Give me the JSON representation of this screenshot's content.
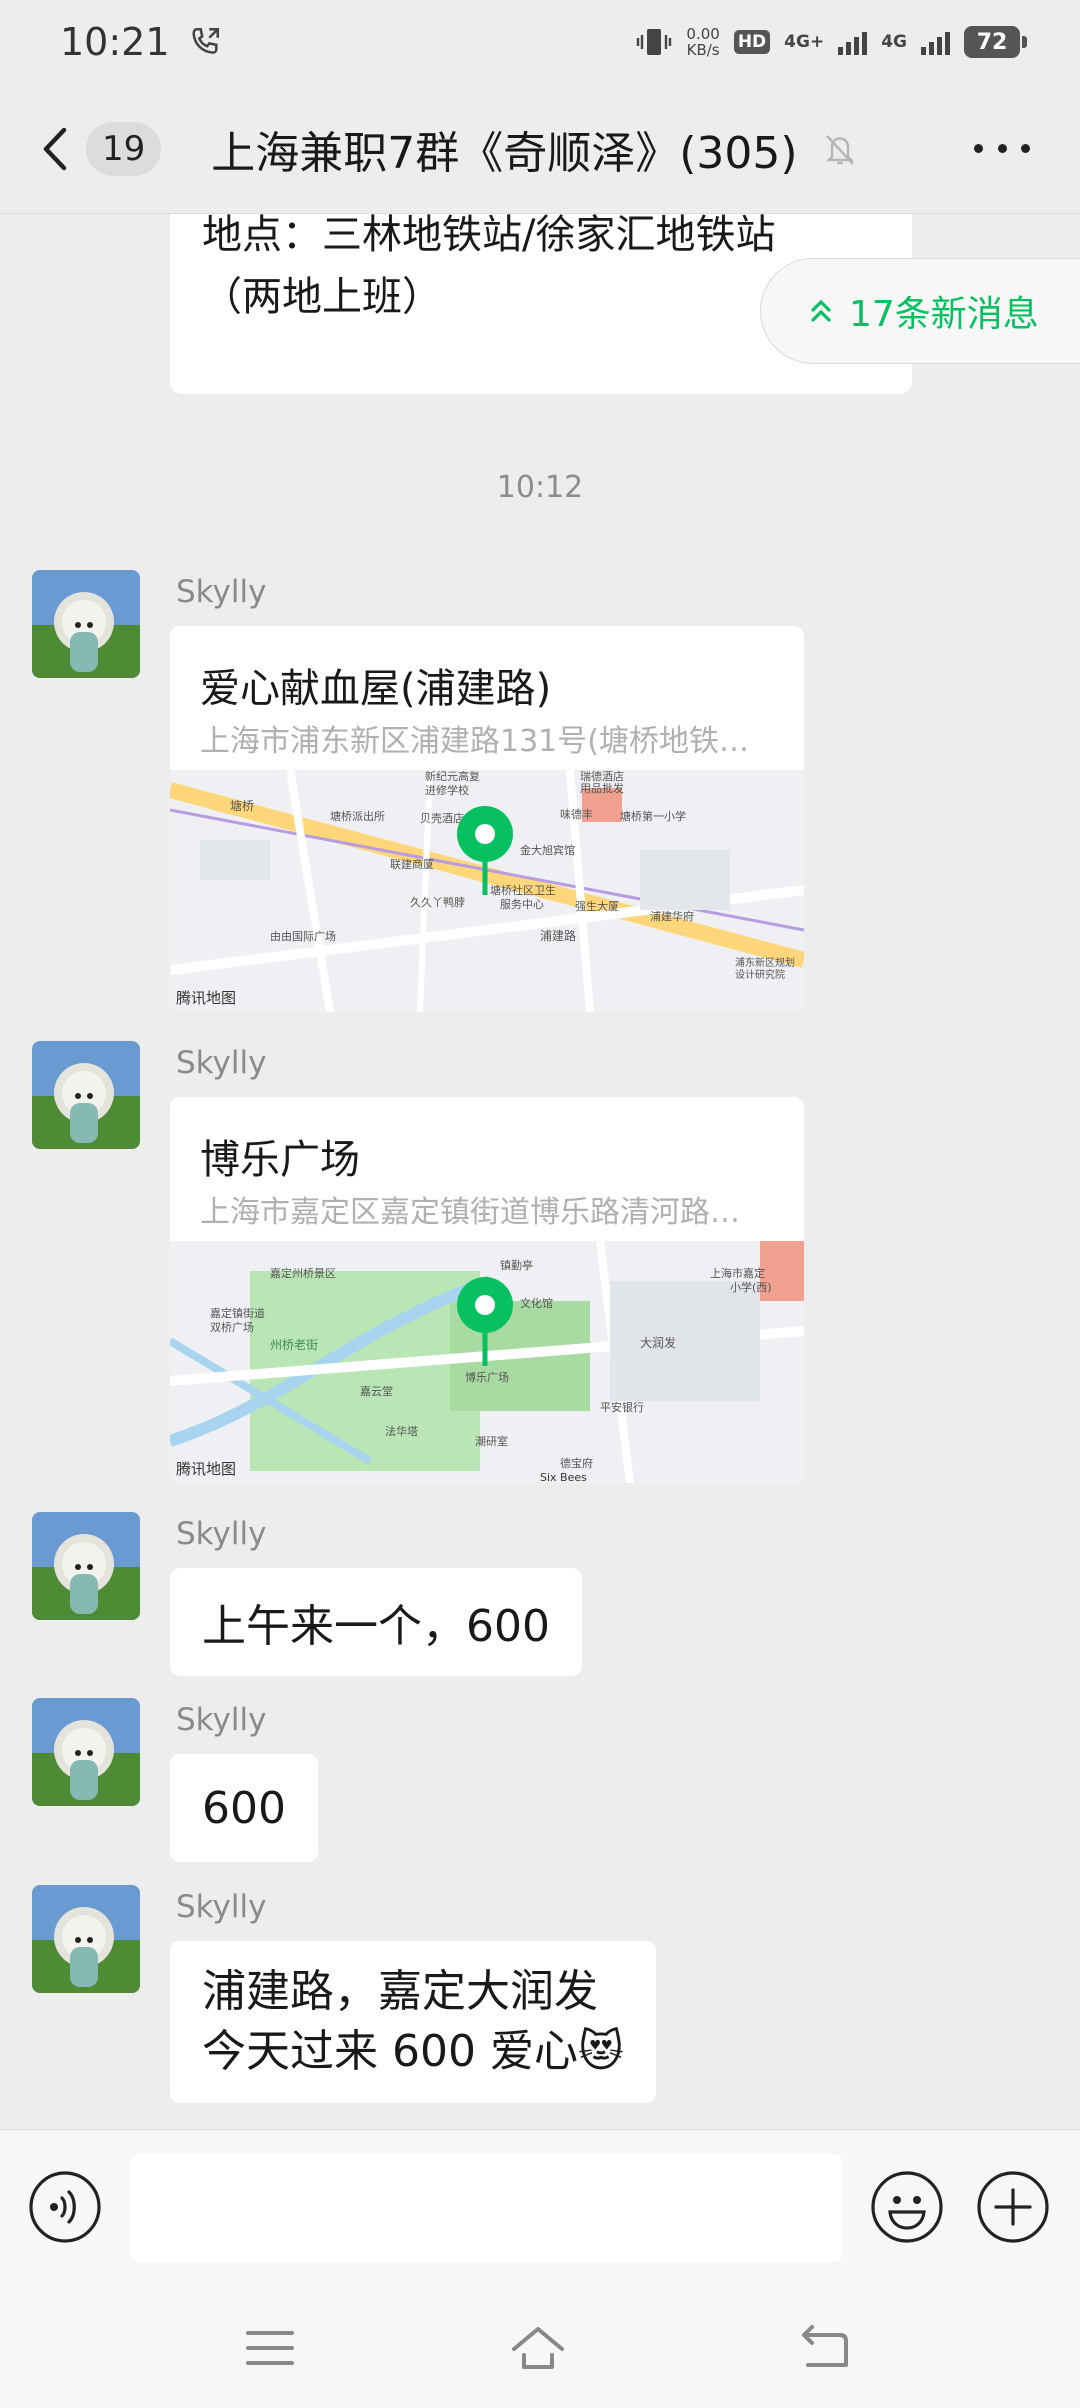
{
  "status_bar": {
    "time": "10:21",
    "speed_value": "0.00",
    "speed_unit": "KB/s",
    "hd_label": "HD",
    "net1": "4G+",
    "net2": "4G",
    "battery": "72"
  },
  "nav": {
    "unread_count": "19",
    "title": "上海兼职7群《奇顺泽》(305)"
  },
  "chat": {
    "prev_message_line1": "地点：三林地铁站/徐家汇地铁站",
    "prev_message_line2": "（两地上班）",
    "new_messages_label": "17条新消息",
    "time_separator": "10:12",
    "messages": [
      {
        "sender": "Skylly",
        "type": "location",
        "name": "爱心献血屋(浦建路)",
        "address": "上海市浦东新区浦建路131号(塘桥地铁站…",
        "map_credit": "腾讯地图"
      },
      {
        "sender": "Skylly",
        "type": "location",
        "name": "博乐广场",
        "address": "上海市嘉定区嘉定镇街道博乐路清河路…",
        "map_credit": "腾讯地图"
      },
      {
        "sender": "Skylly",
        "type": "text",
        "text": "上午来一个，600"
      },
      {
        "sender": "Skylly",
        "type": "text",
        "text": "600"
      },
      {
        "sender": "Skylly",
        "type": "text",
        "line1": "浦建路，嘉定大润发",
        "line2": "今天过来 600 爱心",
        "emoji": "😻"
      }
    ]
  },
  "map1_labels": [
    "塘桥",
    "新纪元高复",
    "进修学校",
    "瑞德酒店",
    "用品批发",
    "味德丰",
    "塘桥派出所",
    "贝壳酒店",
    "塘桥第一小学",
    "联建商厦",
    "金大旭宾馆",
    "久久丫鸭脖",
    "塘桥社区卫生",
    "服务中心",
    "强生大厦",
    "浦建华府",
    "由由国际广场",
    "浦建路",
    "浦东新区规划",
    "设计研究院"
  ],
  "map2_labels": [
    "州桥老街",
    "嘉定州桥景区",
    "嘉定镇街道",
    "双桥广场",
    "博乐广场",
    "镇勤亭",
    "文化馆",
    "嘉云堂",
    "法华塔",
    "平安银行",
    "潮研室",
    "大润发",
    "上海市嘉定",
    "小学(西)",
    "德宝府",
    "Six Bees"
  ],
  "icons": {
    "back": "chevron-left-icon",
    "mute": "bell-off-icon",
    "more": "more-dots-icon",
    "voice": "voice-icon",
    "emoji": "smiley-icon",
    "plus": "plus-circle-icon",
    "menu": "menu-icon",
    "home": "home-icon",
    "back_sys": "return-icon"
  },
  "colors": {
    "accent_green": "#07c160",
    "background": "#ededed",
    "bubble": "#ffffff"
  }
}
